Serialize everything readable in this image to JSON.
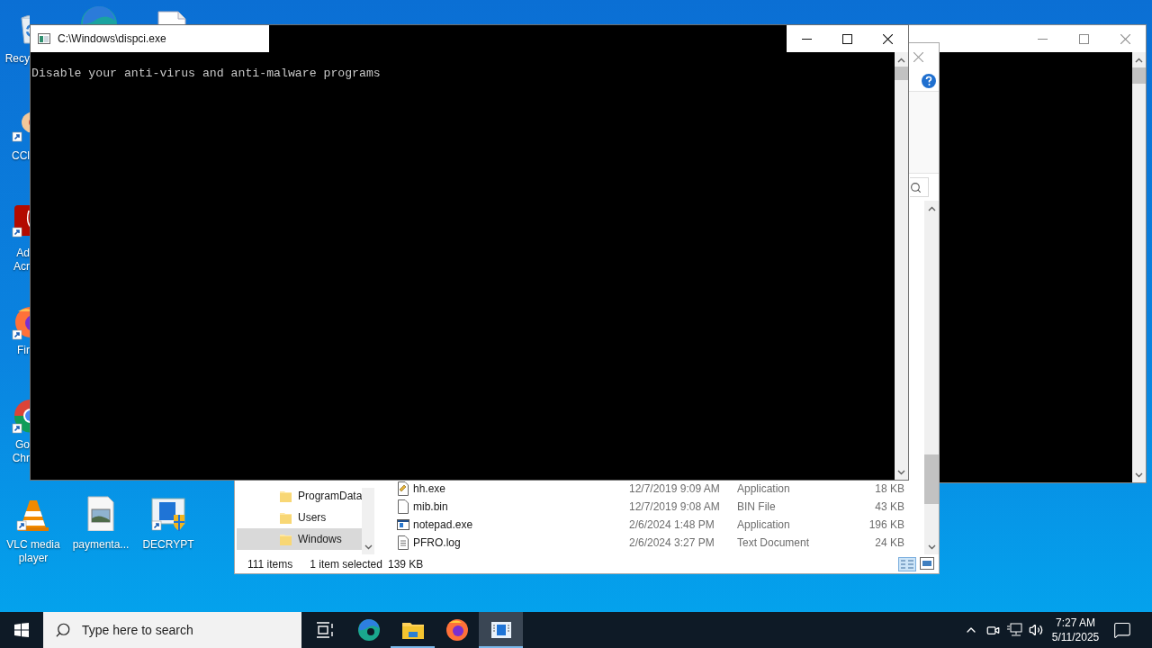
{
  "desktop_icons": [
    {
      "kind": "recycle-bin",
      "label": "Recy"
    },
    {
      "kind": "edge"
    },
    {
      "kind": "document"
    },
    {
      "kind": "ccleaner",
      "label": "CCl"
    },
    {
      "kind": "acrobat",
      "label": "Ad Acr"
    },
    {
      "kind": "firefox",
      "label": "Fir"
    },
    {
      "kind": "chrome",
      "label": "Go Chr"
    },
    {
      "kind": "vlc",
      "label": "VLC media player"
    },
    {
      "kind": "image-file",
      "label": "paymenta..."
    },
    {
      "kind": "decrypt",
      "label": "DECRYPT"
    }
  ],
  "explorer": {
    "nav_items": [
      {
        "label": "ProgramData",
        "selected": false
      },
      {
        "label": "Users",
        "selected": false
      },
      {
        "label": "Windows",
        "selected": true
      }
    ],
    "files": [
      {
        "kind": "tool",
        "name": "hh.exe",
        "modified": "12/7/2019 9:09 AM",
        "type": "Application",
        "size": "18 KB"
      },
      {
        "kind": "blank",
        "name": "mib.bin",
        "modified": "12/7/2019 9:08 AM",
        "type": "BIN File",
        "size": "43 KB"
      },
      {
        "kind": "app",
        "name": "notepad.exe",
        "modified": "2/6/2024 1:48 PM",
        "type": "Application",
        "size": "196 KB"
      },
      {
        "kind": "text",
        "name": "PFRO.log",
        "modified": "2/6/2024 3:27 PM",
        "type": "Text Document",
        "size": "24 KB"
      }
    ],
    "status": {
      "count": "111 items",
      "selection": "1 item selected",
      "size": "139 KB"
    }
  },
  "console": {
    "title": "C:\\Windows\\dispci.exe",
    "lines": [
      "Disable your anti-virus and anti-malware programs"
    ]
  },
  "taskbar": {
    "search": {
      "placeholder": "Type here to search"
    },
    "apps": [
      {
        "kind": "task-view",
        "open": false,
        "active": false
      },
      {
        "kind": "edge",
        "open": false,
        "active": false
      },
      {
        "kind": "explorer",
        "open": true,
        "active": false
      },
      {
        "kind": "firefox",
        "open": false,
        "active": false
      },
      {
        "kind": "console",
        "open": true,
        "active": true
      }
    ],
    "time": "7:27 AM",
    "date": "5/11/2025"
  }
}
